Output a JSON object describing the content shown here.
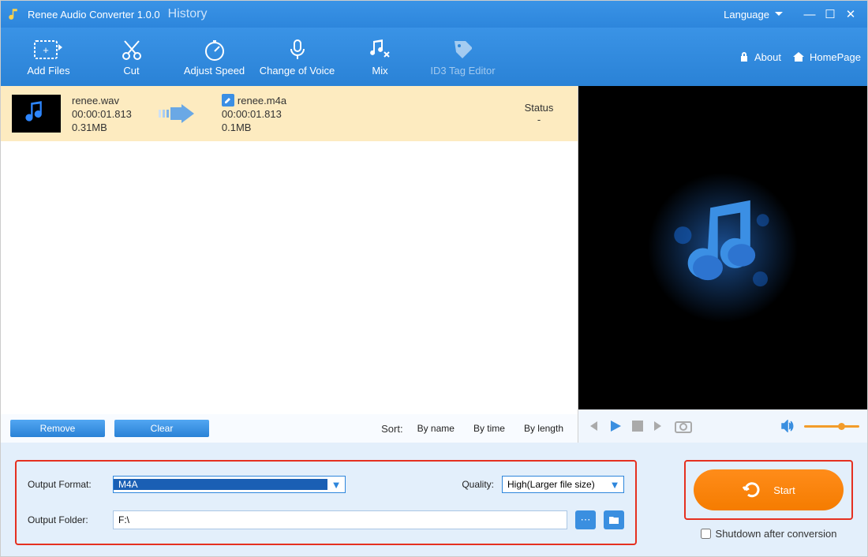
{
  "titlebar": {
    "appname": "Renee Audio Converter 1.0.0",
    "history": "History",
    "language": "Language"
  },
  "toolbar": {
    "add_files": "Add Files",
    "cut": "Cut",
    "adjust_speed": "Adjust Speed",
    "change_voice": "Change of Voice",
    "mix": "Mix",
    "id3": "ID3 Tag Editor",
    "about": "About",
    "homepage": "HomePage"
  },
  "file": {
    "src_name": "renee.wav",
    "src_dur": "00:00:01.813",
    "src_size": "0.31MB",
    "dst_name": "renee.m4a",
    "dst_dur": "00:00:01.813",
    "dst_size": "0.1MB",
    "status_h": "Status",
    "status_v": "-"
  },
  "listbar": {
    "remove": "Remove",
    "clear": "Clear",
    "sort": "Sort:",
    "by_name": "By name",
    "by_time": "By time",
    "by_length": "By length"
  },
  "output": {
    "format_label": "Output Format:",
    "format_value": "M4A",
    "quality_label": "Quality:",
    "quality_value": "High(Larger file size)",
    "folder_label": "Output Folder:",
    "folder_value": "F:\\"
  },
  "start": {
    "label": "Start",
    "shutdown": "Shutdown after conversion"
  }
}
